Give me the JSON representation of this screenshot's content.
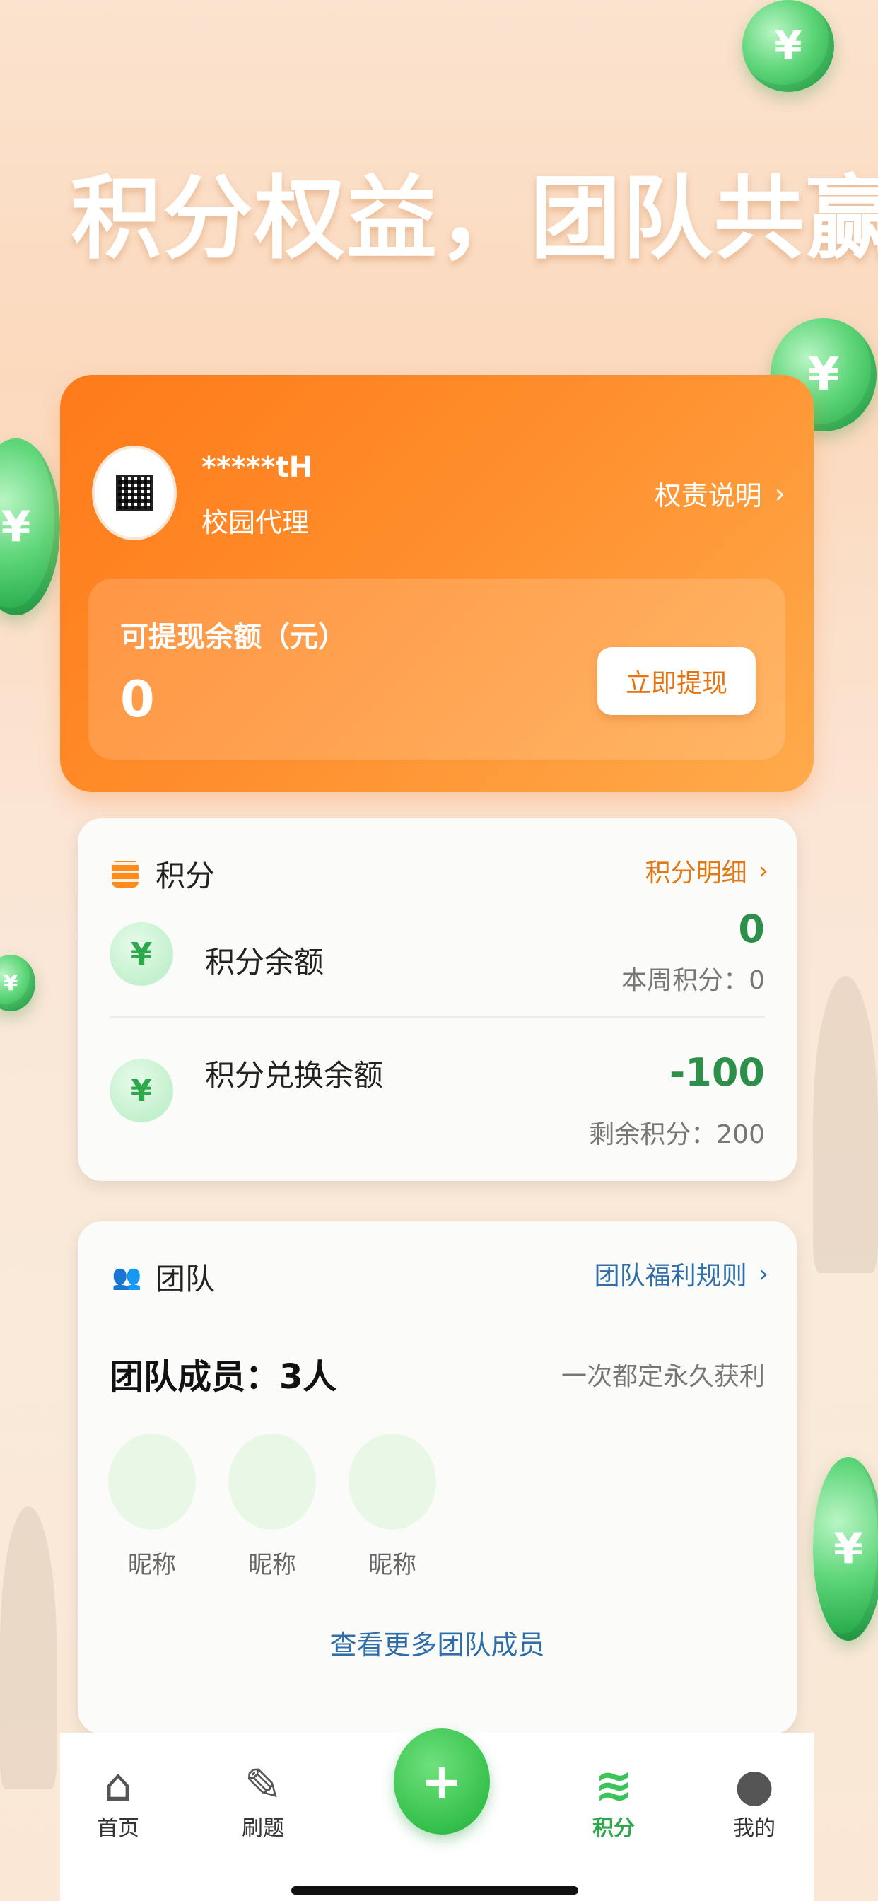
{
  "headline": "积分权益，团队共赢",
  "agent": {
    "username": "*****tH",
    "role": "校园代理",
    "rights_link": "权责说明",
    "balance_label": "可提现余额（元）",
    "balance_value": "0",
    "withdraw_button": "立即提现"
  },
  "points": {
    "title": "积分",
    "detail_link": "积分明细",
    "balance_title": "积分余额",
    "balance_value": "0",
    "weekly_label": "本周积分：0",
    "exchange_title": "积分兑换余额",
    "exchange_value": "-100",
    "remaining_label": "剩余积分：200",
    "yen_symbol": "¥"
  },
  "team": {
    "title": "团队",
    "rules_link": "团队福利规则",
    "members_count": "团队成员：3人",
    "slogan": "一次都定永久获利",
    "members": [
      {
        "nickname": "昵称"
      },
      {
        "nickname": "昵称"
      },
      {
        "nickname": "昵称"
      }
    ],
    "more_link": "查看更多团队成员"
  },
  "tabbar": {
    "items": [
      {
        "label": "首页",
        "icon": "home-icon"
      },
      {
        "label": "刷题",
        "icon": "pencil-ruler-icon"
      },
      {
        "label": "积分",
        "icon": "coins-stack-icon",
        "active": true
      },
      {
        "label": "我的",
        "icon": "user-icon"
      }
    ],
    "fab_symbol": "+"
  },
  "colors": {
    "accent_orange": "#ff7a1a",
    "accent_green": "#2da84d",
    "link_blue": "#2f6ea8"
  }
}
